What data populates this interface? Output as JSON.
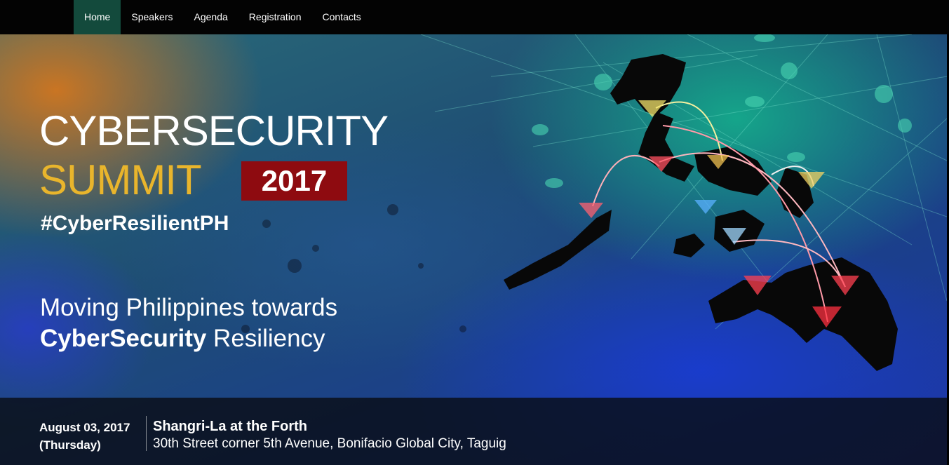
{
  "nav": {
    "items": [
      {
        "label": "Home",
        "active": true
      },
      {
        "label": "Speakers",
        "active": false
      },
      {
        "label": "Agenda",
        "active": false
      },
      {
        "label": "Registration",
        "active": false
      },
      {
        "label": "Contacts",
        "active": false
      }
    ]
  },
  "hero": {
    "title_line1": "CYBERSECURITY",
    "title_line2": "SUMMIT",
    "year": "2017",
    "hashtag": "#CyberResilientPH",
    "tagline_line1": "Moving Philippines towards",
    "tagline_bold": "CyberSecurity",
    "tagline_rest": " Resiliency"
  },
  "event": {
    "date": "August 03, 2017",
    "day": "(Thursday)",
    "venue": "Shangri-La at the Forth",
    "address": "30th Street corner 5th Avenue, Bonifacio Global City, Taguig"
  },
  "colors": {
    "nav_active": "#134a3c",
    "title_accent": "#e9b52c",
    "year_badge": "#8e0b10"
  },
  "icons": {
    "map": "philippines-map-icon"
  }
}
